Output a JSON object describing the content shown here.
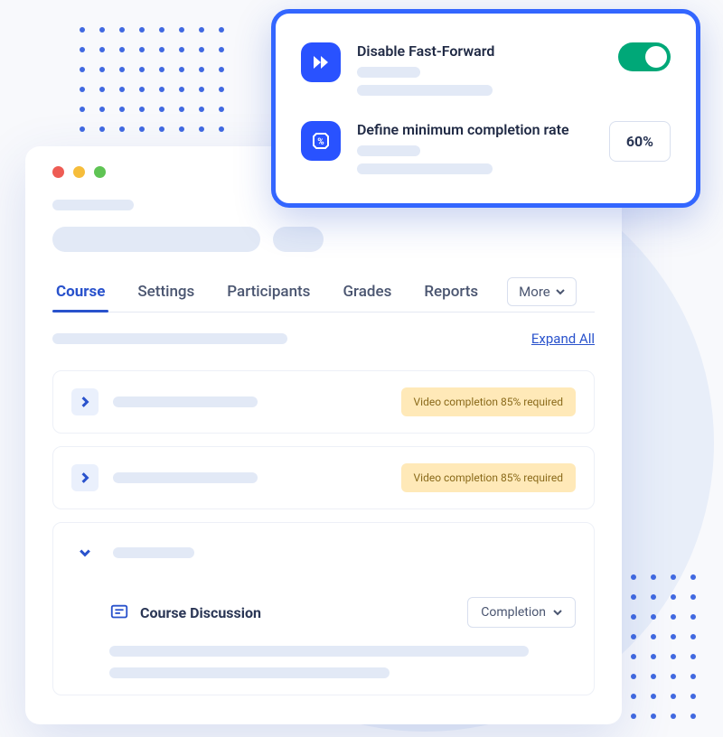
{
  "settings_card": {
    "items": [
      {
        "title": "Disable Fast-Forward",
        "control_type": "toggle",
        "value": true
      },
      {
        "title": "Define minimum completion rate",
        "control_type": "value",
        "value": "60%"
      }
    ]
  },
  "tabs": {
    "items": [
      "Course",
      "Settings",
      "Participants",
      "Grades",
      "Reports"
    ],
    "active_index": 0,
    "more_label": "More"
  },
  "expand_all_label": "Expand All",
  "course_items": [
    {
      "expanded": false,
      "badge": "Video completion 85% required"
    },
    {
      "expanded": false,
      "badge": "Video completion 85% required"
    },
    {
      "expanded": true,
      "discussion_title": "Course Discussion",
      "completion_label": "Completion"
    }
  ]
}
